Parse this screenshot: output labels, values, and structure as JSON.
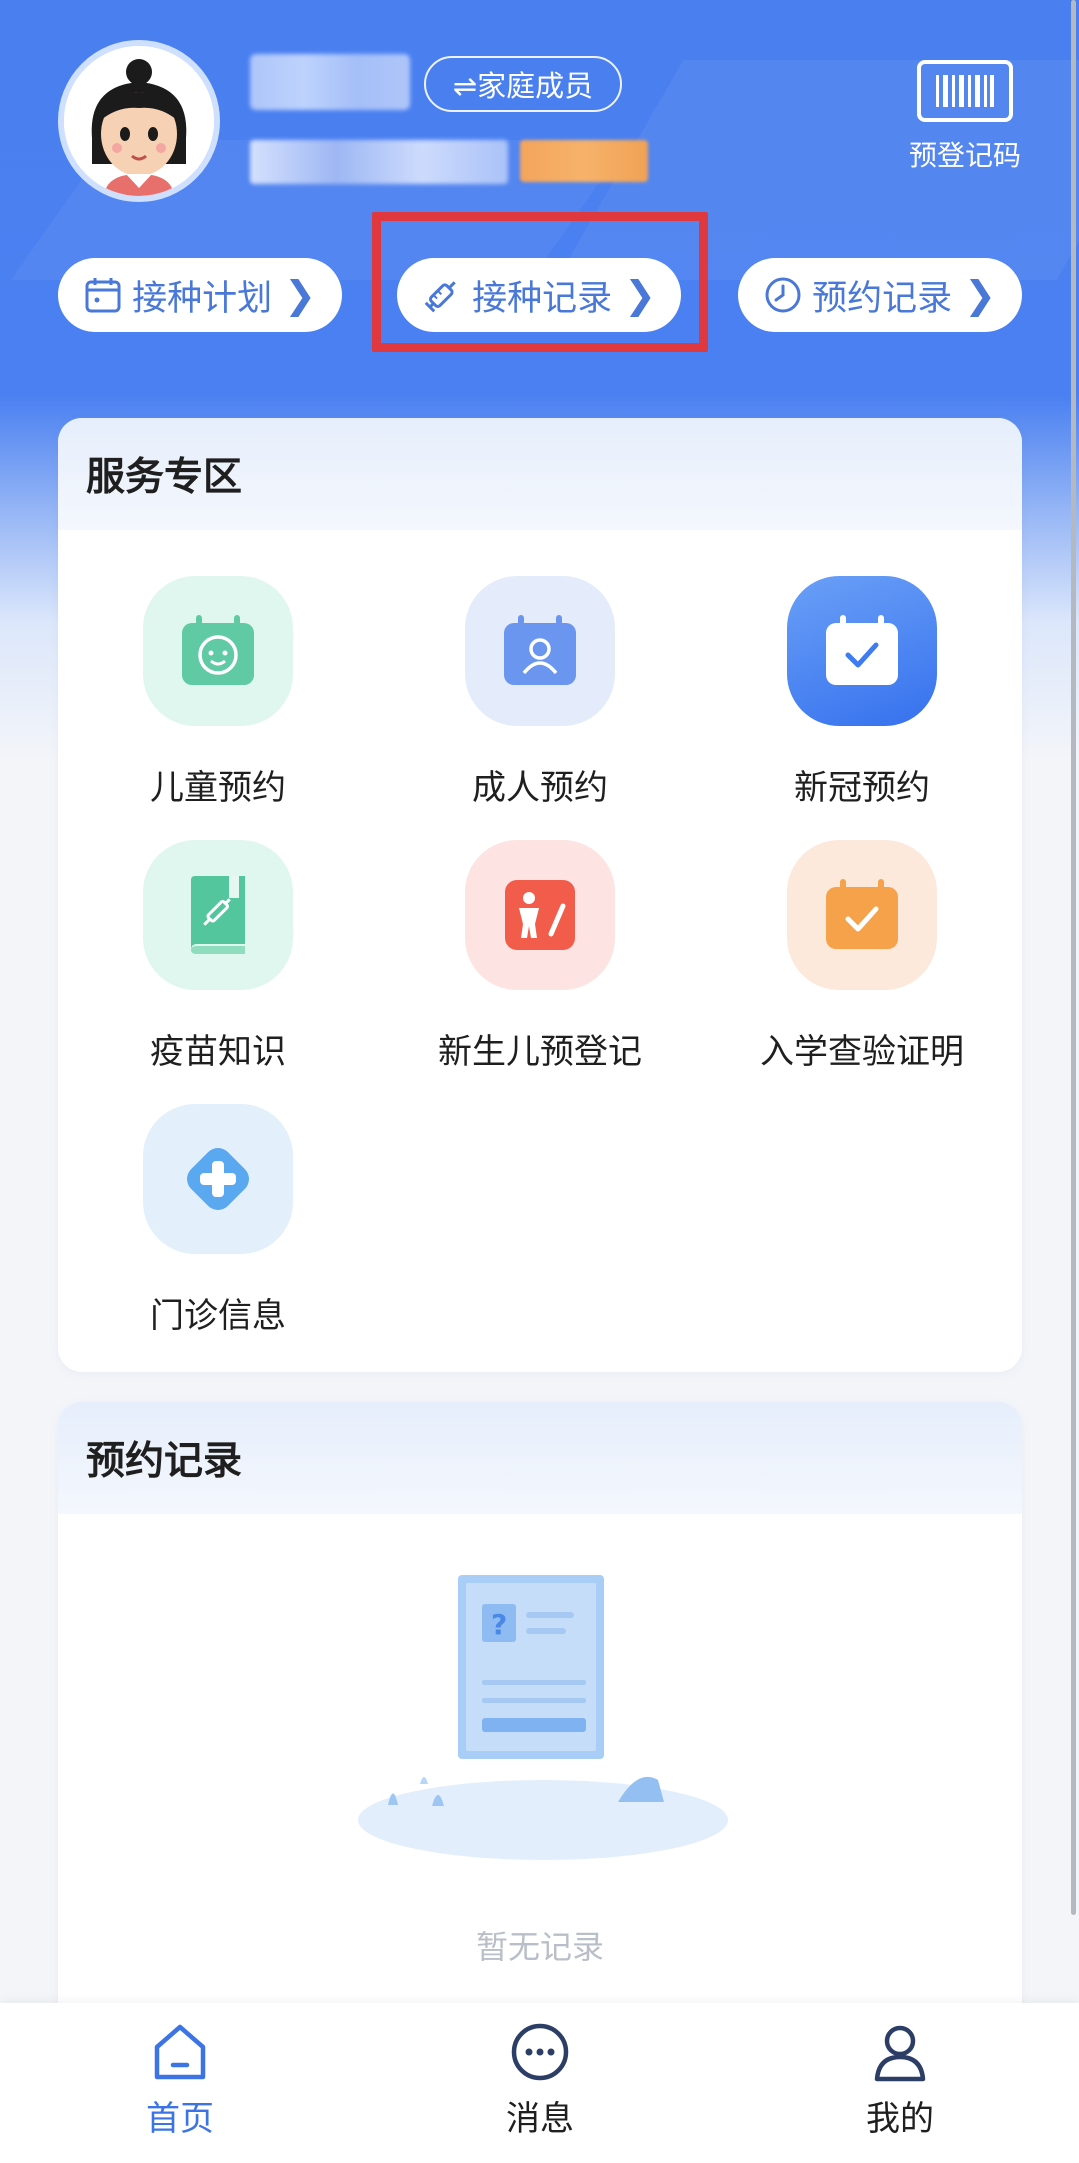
{
  "header": {
    "family_member_label": "⇌家庭成员",
    "barcode_label": "预登记码"
  },
  "quick_links": [
    {
      "label": "接种计划",
      "icon": "calendar-icon"
    },
    {
      "label": "接种记录",
      "icon": "syringe-icon"
    },
    {
      "label": "预约记录",
      "icon": "clock-icon"
    }
  ],
  "service_zone": {
    "title": "服务专区",
    "items": [
      {
        "label": "儿童预约",
        "icon": "child-calendar-icon",
        "color": "#5fcaa3"
      },
      {
        "label": "成人预约",
        "icon": "adult-calendar-icon",
        "color": "#6a96ef"
      },
      {
        "label": "新冠预约",
        "icon": "covid-calendar-icon",
        "color": "#3f7cf2"
      },
      {
        "label": "疫苗知识",
        "icon": "vaccine-book-icon",
        "color": "#54c69d"
      },
      {
        "label": "新生儿预登记",
        "icon": "newborn-register-icon",
        "color": "#f25c4a"
      },
      {
        "label": "入学查验证明",
        "icon": "school-check-icon",
        "color": "#f5a24a"
      },
      {
        "label": "门诊信息",
        "icon": "clinic-plus-icon",
        "color": "#5aa8f0"
      }
    ]
  },
  "appointment_records": {
    "title": "预约记录",
    "empty_text": "暂无记录"
  },
  "tabbar": {
    "items": [
      {
        "label": "首页",
        "icon": "home-icon",
        "active": true
      },
      {
        "label": "消息",
        "icon": "message-icon",
        "active": false
      },
      {
        "label": "我的",
        "icon": "user-icon",
        "active": false
      }
    ]
  },
  "colors": {
    "primary": "#4a80f1",
    "link_text": "#4a78d8",
    "highlight": "#e0383f",
    "active_tab": "#3c74e6"
  }
}
